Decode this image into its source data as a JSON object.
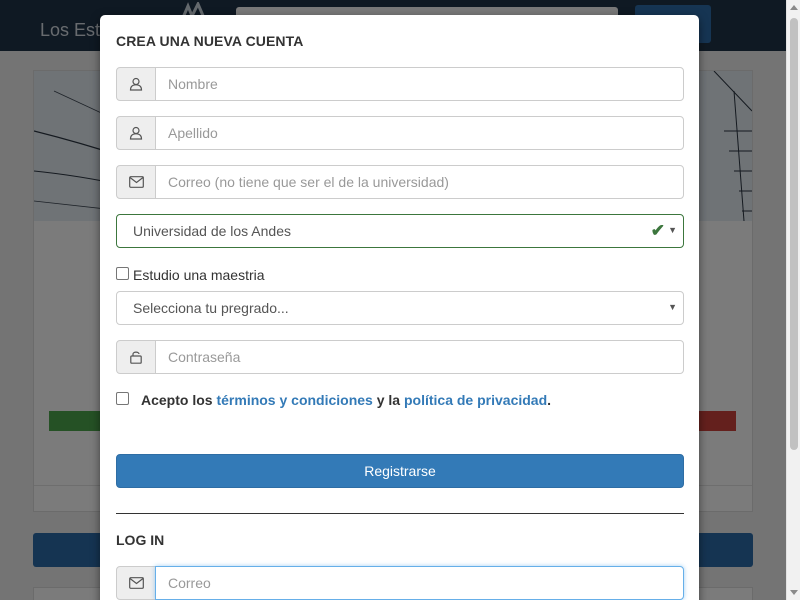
{
  "navbar": {
    "brand": "Los Est"
  },
  "modal": {
    "title": "CREA UNA NUEVA CUENTA",
    "fields": {
      "first_name_placeholder": "Nombre",
      "last_name_placeholder": "Apellido",
      "email_placeholder": "Correo (no tiene que ser el de la universidad)",
      "password_placeholder": "Contraseña"
    },
    "university": {
      "selected": "Universidad de los Andes"
    },
    "masters_checkbox_label": "Estudio una maestria",
    "undergrad_select": {
      "selected": "Selecciona tu pregrado..."
    },
    "terms": {
      "prefix": "Acepto los",
      "terms_link": "términos y condiciones",
      "middle": "y la",
      "privacy_link": "política de privacidad",
      "suffix": "."
    },
    "register_button": "Registrarse",
    "login": {
      "title": "LOG IN",
      "email_placeholder": "Correo"
    }
  },
  "icons": {
    "user": "user-icon",
    "email": "envelope-icon",
    "lock": "lock-icon",
    "check": "check-icon",
    "caret": "caret-down-icon"
  },
  "colors": {
    "navbar": "#1f3347",
    "primary": "#337ab7",
    "success": "#3c763d",
    "link": "#337ab7"
  }
}
